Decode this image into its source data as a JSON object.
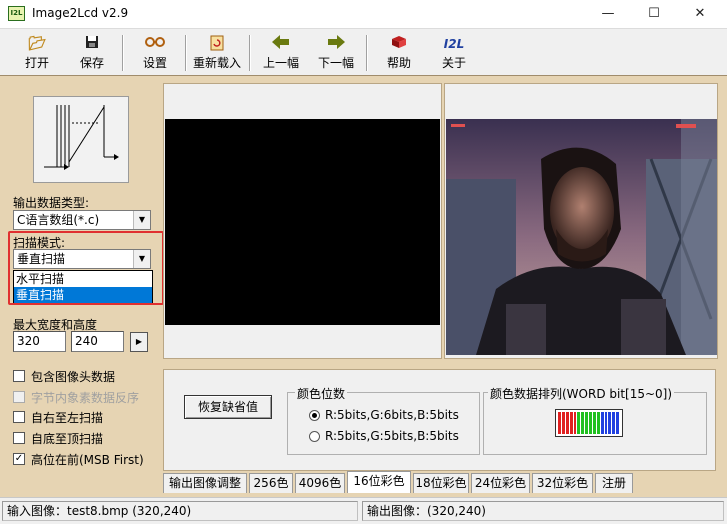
{
  "window": {
    "title": "Image2Lcd v2.9",
    "app_icon_text": "I2L",
    "minimize": "—",
    "maximize": "☐",
    "close": "✕"
  },
  "toolbar": [
    {
      "id": "open",
      "label": "打开",
      "icon": "open-folder-icon"
    },
    {
      "id": "save",
      "label": "保存",
      "icon": "floppy-disk-icon"
    },
    {
      "id": "settings",
      "label": "设置",
      "icon": "glasses-icon"
    },
    {
      "id": "reload",
      "label": "重新载入",
      "icon": "reload-icon"
    },
    {
      "id": "prev",
      "label": "上一幅",
      "icon": "arrow-left-icon"
    },
    {
      "id": "next",
      "label": "下一幅",
      "icon": "arrow-right-icon"
    },
    {
      "id": "help",
      "label": "帮助",
      "icon": "help-book-icon"
    },
    {
      "id": "about",
      "label": "关于",
      "icon": "i2l-logo-icon"
    }
  ],
  "left": {
    "output_type_label": "输出数据类型:",
    "output_type_value": "C语言数组(*.c)",
    "scan_mode_label": "扫描模式:",
    "scan_mode_value": "垂直扫描",
    "scan_options": [
      "水平扫描",
      "垂直扫描"
    ],
    "max_size_label": "最大宽度和高度",
    "max_width": "320",
    "max_height": "240",
    "checkboxes": [
      {
        "label": "包含图像头数据",
        "checked": false,
        "enabled": true
      },
      {
        "label": "字节内象素数据反序",
        "checked": false,
        "enabled": false
      },
      {
        "label": "自右至左扫描",
        "checked": false,
        "enabled": true
      },
      {
        "label": "自底至顶扫描",
        "checked": false,
        "enabled": true
      },
      {
        "label": "高位在前(MSB First)",
        "checked": true,
        "enabled": true
      }
    ]
  },
  "options": {
    "restore_button": "恢复缺省值",
    "color_bits_title": "颜色位数",
    "radios": [
      {
        "label": "R:5bits,G:6bits,B:5bits",
        "checked": true
      },
      {
        "label": "R:5bits,G:5bits,B:5bits",
        "checked": false
      }
    ],
    "arrangement_title": "颜色数据排列(WORD bit[15~0])",
    "bit_colors": [
      "#e02020",
      "#e02020",
      "#e02020",
      "#e02020",
      "#e02020",
      "#20c020",
      "#20c020",
      "#20c020",
      "#20c020",
      "#20c020",
      "#20c020",
      "#2040e0",
      "#2040e0",
      "#2040e0",
      "#2040e0",
      "#2040e0"
    ]
  },
  "tabs": [
    "输出图像调整",
    "256色",
    "4096色",
    "16位彩色",
    "18位彩色",
    "24位彩色",
    "32位彩色",
    "注册"
  ],
  "active_tab": 3,
  "status": {
    "input": "输入图像：test8.bmp (320,240)",
    "output": "输出图像：(320,240)"
  }
}
